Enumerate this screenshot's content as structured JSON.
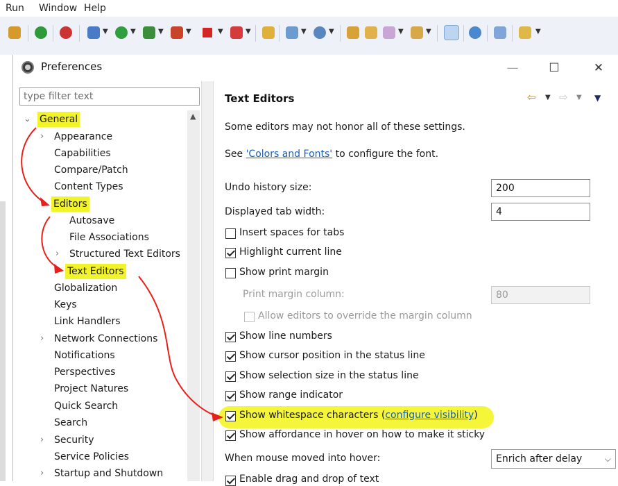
{
  "menubar": {
    "items": [
      "Run",
      "Window",
      "Help"
    ]
  },
  "dialog": {
    "title": "Preferences",
    "controls": {
      "minimize": "—",
      "maximize": "☐",
      "close": "✕"
    }
  },
  "filter": {
    "placeholder": "type filter text"
  },
  "tree": {
    "general": "General",
    "appearance": "Appearance",
    "capabilities": "Capabilities",
    "compare_patch": "Compare/Patch",
    "content_types": "Content Types",
    "editors": "Editors",
    "autosave": "Autosave",
    "file_associations": "File Associations",
    "structured_text_editors": "Structured Text Editors",
    "text_editors": "Text Editors",
    "globalization": "Globalization",
    "keys": "Keys",
    "link_handlers": "Link Handlers",
    "network_connections": "Network Connections",
    "notifications": "Notifications",
    "perspectives": "Perspectives",
    "project_natures": "Project Natures",
    "quick_search": "Quick Search",
    "search": "Search",
    "security": "Security",
    "service_policies": "Service Policies",
    "startup_and_shutdown": "Startup and Shutdown"
  },
  "page": {
    "title": "Text Editors",
    "intro": "Some editors may not honor all of these settings.",
    "see_prefix": "See ",
    "colors_link": "'Colors and Fonts'",
    "see_suffix": " to configure the font.",
    "undo_label": "Undo history size:",
    "undo_value": "200",
    "tab_label": "Displayed tab width:",
    "tab_value": "4",
    "insert_spaces": "Insert spaces for tabs",
    "highlight_line": "Highlight current line",
    "show_print_margin": "Show print margin",
    "print_margin_label": "Print margin column:",
    "print_margin_value": "80",
    "allow_override": "Allow editors to override the margin column",
    "line_numbers": "Show line numbers",
    "cursor_position": "Show cursor position in the status line",
    "selection_size": "Show selection size in the status line",
    "range_indicator": "Show range indicator",
    "whitespace": "Show whitespace characters",
    "whitespace_open": " (",
    "configure_visibility": "configure visibility",
    "whitespace_close": ")",
    "affordance": "Show affordance in hover on how to make it sticky",
    "hover_label": "When mouse moved into hover:",
    "hover_value": "Enrich after delay",
    "drag_drop": "Enable drag and drop of text"
  },
  "colors": {
    "highlight": "#f5f53a",
    "annotation": "#e8201a",
    "link": "#1a5fb4"
  }
}
